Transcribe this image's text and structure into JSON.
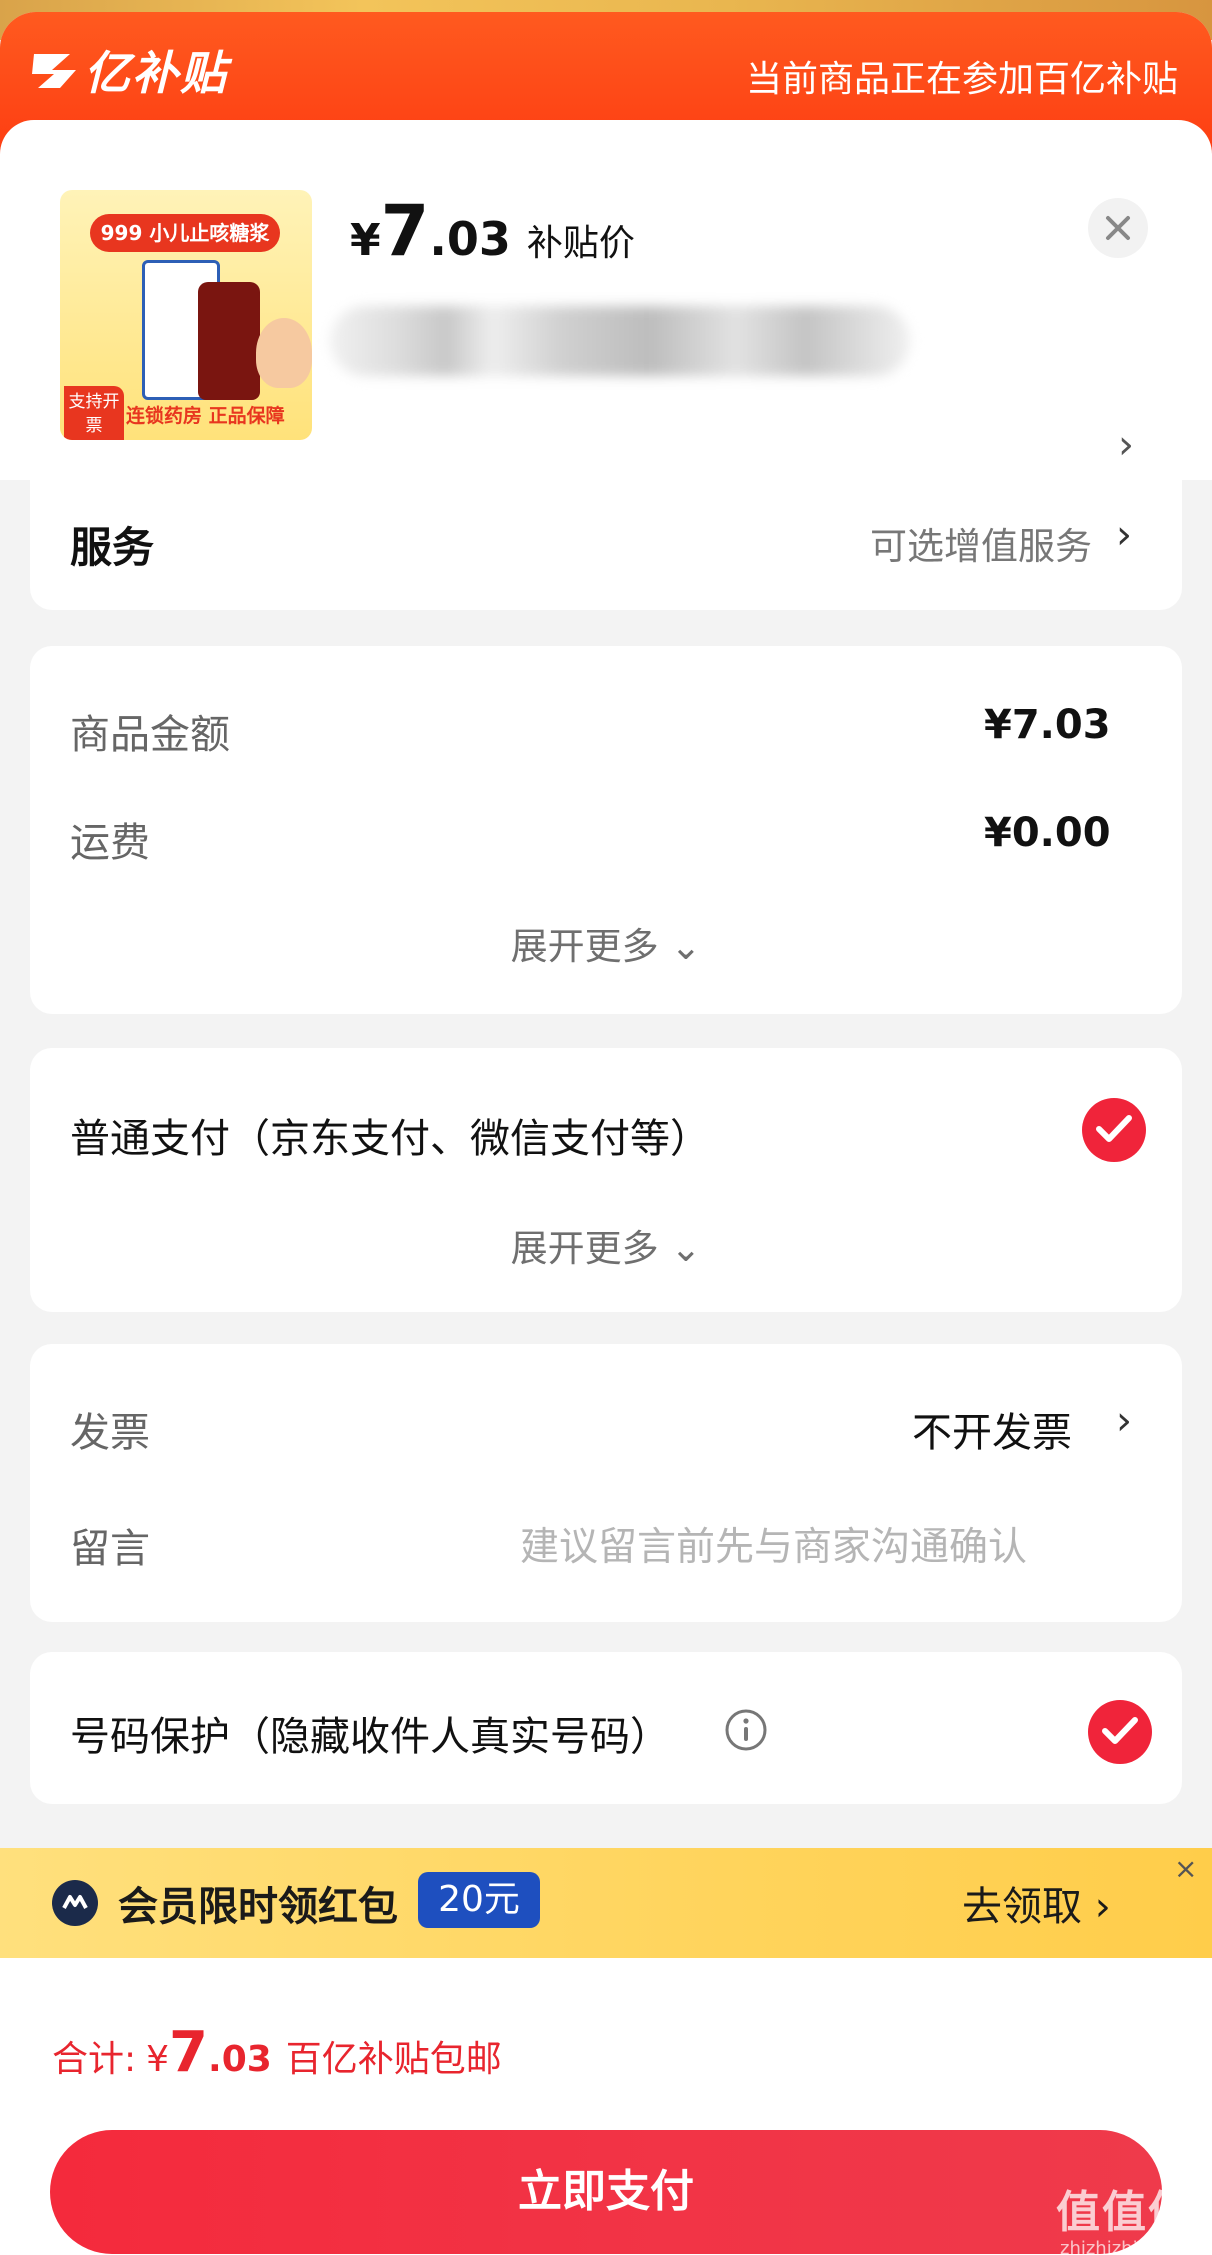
{
  "banner": {
    "logo_text": "亿补贴",
    "notice": "当前商品正在参加百亿补贴"
  },
  "product": {
    "thumb": {
      "title": "999 小儿止咳糖浆",
      "badge": "支持开票",
      "footer": "连锁药房 正品保障"
    },
    "price": {
      "currency": "¥",
      "integer": "7",
      "decimal": ".03",
      "tag": "补贴价"
    },
    "close_icon": "close-icon",
    "chevron": "›"
  },
  "service": {
    "label": "服务",
    "value": "可选增值服务",
    "chevron": "›"
  },
  "amounts": {
    "goods_label": "商品金额",
    "goods_value": "¥7.03",
    "shipping_label": "运费",
    "shipping_value": "¥0.00",
    "expand": "展开更多 ⌄"
  },
  "payment": {
    "label": "普通支付（京东支付、微信支付等）",
    "checked": true,
    "expand": "展开更多 ⌄"
  },
  "invoice": {
    "label": "发票",
    "value": "不开发票",
    "chevron": "›",
    "message_label": "留言",
    "message_placeholder": "建议留言前先与商家沟通确认"
  },
  "privacy": {
    "label": "号码保护（隐藏收件人真实号码）",
    "info_icon": "info-icon",
    "checked": true
  },
  "promo": {
    "text": "会员限时领红包",
    "badge": "20元",
    "action": "去领取 ›",
    "close": "×"
  },
  "footer": {
    "total_label": "合计:",
    "currency": "¥",
    "integer": "7",
    "decimal": ".03",
    "note": "百亿补贴包邮",
    "pay_button": "立即支付"
  },
  "watermark": {
    "text": "值值值",
    "sub": "zhizhizhi.com"
  },
  "colors": {
    "banner": "#fd3d12",
    "accent_red": "#f0243a",
    "promo_yellow": "#ffd45c",
    "promo_badge": "#1e4fbf"
  }
}
